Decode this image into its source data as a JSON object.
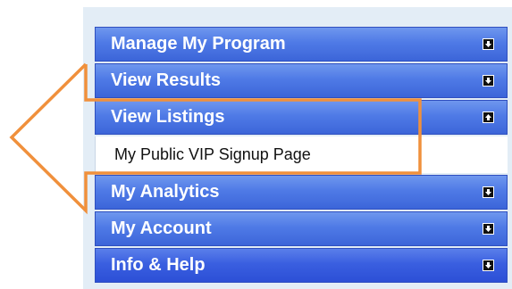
{
  "menu": {
    "items": [
      {
        "label": "Manage My Program",
        "state": "collapsed",
        "toggle_icon": "arrow-down-icon"
      },
      {
        "label": "View Results",
        "state": "collapsed",
        "toggle_icon": "arrow-down-icon"
      },
      {
        "label": "View Listings",
        "state": "expanded",
        "toggle_icon": "arrow-up-icon"
      },
      {
        "label": "My Analytics",
        "state": "collapsed",
        "toggle_icon": "arrow-down-icon"
      },
      {
        "label": "My Account",
        "state": "collapsed",
        "toggle_icon": "arrow-down-icon"
      },
      {
        "label": "Info & Help",
        "state": "collapsed",
        "toggle_icon": "arrow-down-icon"
      }
    ],
    "sub_items": [
      {
        "label": "My Public VIP Signup Page"
      }
    ]
  },
  "colors": {
    "menu_blue": "#4f7ae6",
    "annotation_orange": "#f0903c",
    "panel_background": "#e3edf6"
  },
  "annotation": {
    "shape": "arrow-callout",
    "points_to": "My Public VIP Signup Page"
  }
}
